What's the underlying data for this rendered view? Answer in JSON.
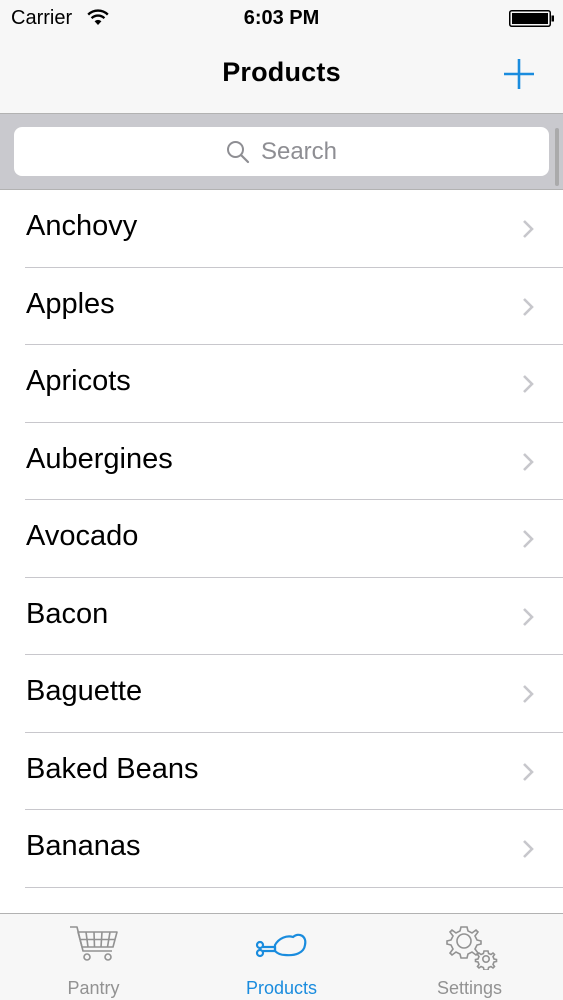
{
  "status_bar": {
    "carrier": "Carrier",
    "time": "6:03 PM",
    "icons": [
      "wifi-icon",
      "battery-icon"
    ]
  },
  "nav_bar": {
    "title": "Products",
    "add_button_icon": "plus-icon",
    "accent_color": "#1a8cde"
  },
  "search": {
    "placeholder": "Search",
    "icon": "search-icon"
  },
  "product_list": {
    "items": [
      {
        "label": "Anchovy"
      },
      {
        "label": "Apples"
      },
      {
        "label": "Apricots"
      },
      {
        "label": "Aubergines"
      },
      {
        "label": "Avocado"
      },
      {
        "label": "Bacon"
      },
      {
        "label": "Baguette"
      },
      {
        "label": "Baked Beans"
      },
      {
        "label": "Bananas"
      }
    ],
    "item_accessory_icon": "chevron-right-icon"
  },
  "tab_bar": {
    "tabs": [
      {
        "label": "Pantry",
        "icon": "cart-icon",
        "active": false
      },
      {
        "label": "Products",
        "icon": "chicken-leg-icon",
        "active": true
      },
      {
        "label": "Settings",
        "icon": "gears-icon",
        "active": false
      }
    ],
    "active_color": "#1a8cde",
    "inactive_color": "#929292"
  }
}
